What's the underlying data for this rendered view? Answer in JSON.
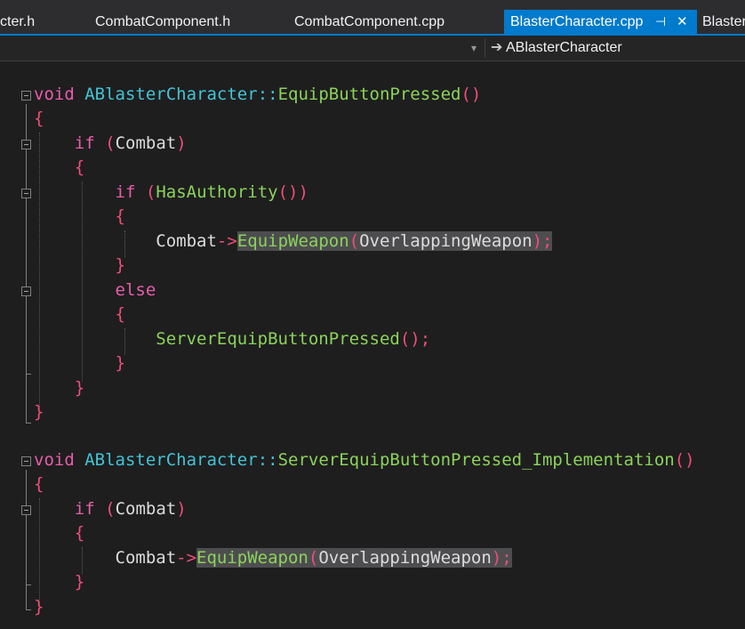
{
  "tabs": [
    {
      "label": "cter.h"
    },
    {
      "label": "CombatComponent.h"
    },
    {
      "label": "CombatComponent.cpp"
    },
    {
      "label": "BlasterCharacter.cpp",
      "pin": "⊣",
      "close": "✕"
    },
    {
      "label": "Blaster"
    }
  ],
  "nav": {
    "dropdown_arrow": "▾",
    "member_arrow": "➔",
    "member": "ABlasterCharacter"
  },
  "code": {
    "f1_void": "void",
    "f1_class": "ABlasterCharacter",
    "scope": "::",
    "f1_name": "EquipButtonPressed",
    "paren_pair": "()",
    "open_brace": "{",
    "close_brace": "}",
    "if_kw": "if",
    "open_paren": "(",
    "close_paren": ")",
    "combat": "Combat",
    "has_authority": "HasAuthority",
    "arrow": "->",
    "equip_weapon": "EquipWeapon",
    "overlapping_weapon": "OverlappingWeapon",
    "close_call": ");",
    "else_kw": "else",
    "server_equip": "ServerEquipButtonPressed",
    "empty_call": "();",
    "f2_name": "ServerEquipButtonPressed_Implementation"
  }
}
